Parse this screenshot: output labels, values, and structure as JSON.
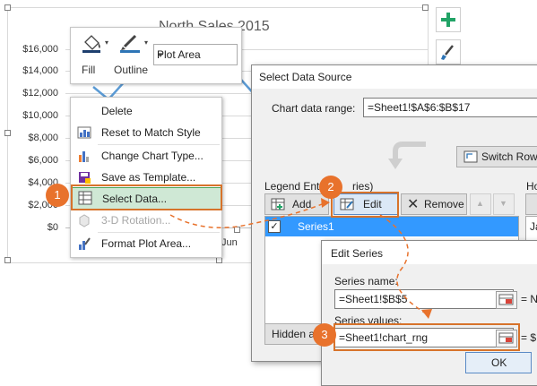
{
  "chart": {
    "title": "North Sales 2015",
    "y_ticks": [
      "$16,000",
      "$14,000",
      "$12,000",
      "$10,000",
      "$8,000",
      "$6,000",
      "$4,000",
      "$2,000",
      "$0"
    ],
    "x_tick_visible": "Jun"
  },
  "mini_toolbar": {
    "fill_label": "Fill",
    "outline_label": "Outline",
    "element_select_value": "Plot Area"
  },
  "context_menu": {
    "items": [
      {
        "label": "Delete"
      },
      {
        "label": "Reset to Match Style"
      },
      {
        "label": "Change Chart Type..."
      },
      {
        "label": "Save as Template..."
      },
      {
        "label": "Select Data..."
      },
      {
        "label": "3-D Rotation..."
      },
      {
        "label": "Format Plot Area..."
      }
    ]
  },
  "callouts": {
    "one": "1",
    "two": "2",
    "three": "3"
  },
  "select_data_source": {
    "title": "Select Data Source",
    "chart_data_range_label": "Chart data range:",
    "chart_data_range_value": "=Sheet1!$A$6:$B$17",
    "switch_label": "Switch Row/",
    "legend_entries_label": "Legend Entri",
    "legend_entries_suffix": "ries)",
    "horizontal_label_partial": "Ho",
    "add_label": "Add",
    "edit_label": "Edit",
    "remove_label": "Remove",
    "series_item": "Series1",
    "category_partial": "Ja",
    "hidden_button_partial": "Hidden a"
  },
  "edit_series": {
    "title": "Edit Series",
    "name_label": "Series name:",
    "name_value": "=Sheet1!$B$5",
    "name_result_partial": "= N",
    "values_label": "Series values:",
    "values_value": "=Sheet1!chart_rng",
    "values_result_partial": "= $",
    "ok_label": "OK"
  },
  "colors": {
    "accent_orange": "#e8722c",
    "chart_line": "#5b9bd5",
    "selection_green": "#cfe8d5",
    "list_selection_blue": "#3399ff"
  }
}
